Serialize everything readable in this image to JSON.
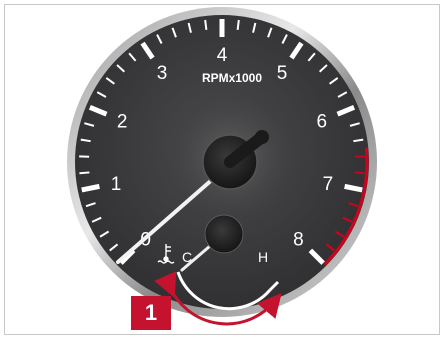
{
  "gauge": {
    "unit_label": "RPMx1000",
    "numbers": [
      "0",
      "1",
      "2",
      "3",
      "4",
      "5",
      "6",
      "7",
      "8"
    ],
    "redline_from": 6.5,
    "needle_value": 0
  },
  "temperature": {
    "cold_label": "C",
    "hot_label": "H",
    "icon": "coolant-temperature-icon"
  },
  "callout": {
    "label": "1"
  },
  "colors": {
    "face": "#3a3a3c",
    "redline": "#d0021b",
    "callout": "#c4122f",
    "arrow": "#c4122f"
  }
}
